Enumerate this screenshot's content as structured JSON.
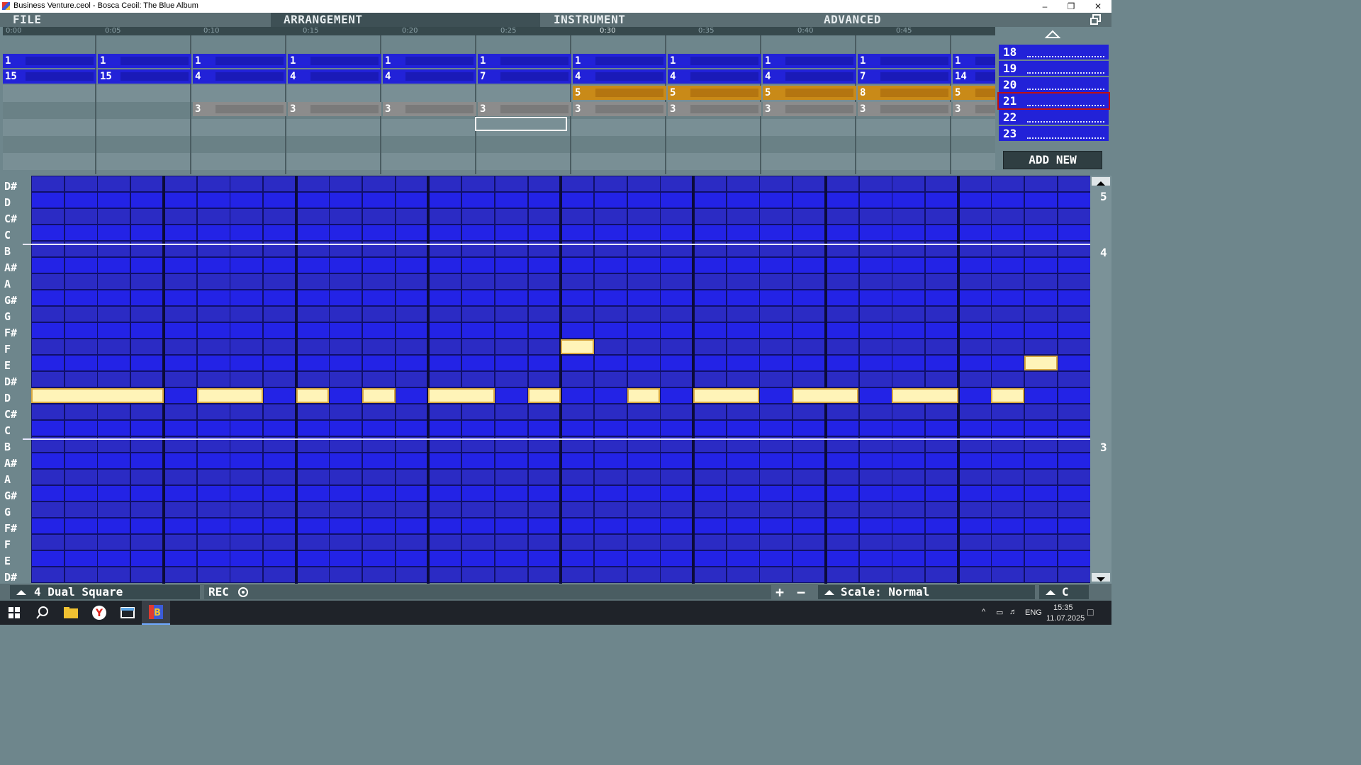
{
  "window": {
    "title": "Business Venture.ceol - Bosca Ceoil: The Blue Album",
    "minimize": "–",
    "restore": "❐",
    "close": "✕"
  },
  "menu": {
    "file": "FILE",
    "arrangement": "ARRANGEMENT",
    "instrument": "INSTRUMENT",
    "advanced": "ADVANCED",
    "fullscreen_icon": "fullscreen-icon"
  },
  "timeline": {
    "times": [
      "0:00",
      "0:05",
      "0:10",
      "0:15",
      "0:20",
      "0:25",
      "0:30",
      "0:35",
      "0:40",
      "0:45"
    ]
  },
  "arrangement": {
    "columns": [
      {
        "r1": "1",
        "r2": "15",
        "r3": "",
        "r4": ""
      },
      {
        "r1": "1",
        "r2": "15",
        "r3": "",
        "r4": ""
      },
      {
        "r1": "1",
        "r2": "4",
        "r3": "",
        "r4": "3"
      },
      {
        "r1": "1",
        "r2": "4",
        "r3": "",
        "r4": "3"
      },
      {
        "r1": "1",
        "r2": "4",
        "r3": "",
        "r4": "3"
      },
      {
        "r1": "1",
        "r2": "7",
        "r3": "",
        "r4": "3"
      },
      {
        "r1": "1",
        "r2": "4",
        "r3": "5",
        "r4": "3"
      },
      {
        "r1": "1",
        "r2": "4",
        "r3": "5",
        "r4": "3"
      },
      {
        "r1": "1",
        "r2": "4",
        "r3": "5",
        "r4": "3"
      },
      {
        "r1": "1",
        "r2": "7",
        "r3": "8",
        "r4": "3"
      },
      {
        "r1": "1",
        "r2": "14",
        "r3": "5",
        "r4": "3"
      }
    ]
  },
  "pattern_list": {
    "up_icon": "chevron-up-icon",
    "items": [
      "18",
      "19",
      "20",
      "21",
      "22",
      "23"
    ],
    "selected": "21",
    "add_new": "ADD NEW"
  },
  "piano": {
    "keys": [
      "D#",
      "D",
      "C#",
      "C",
      "B",
      "A#",
      "A",
      "G#",
      "G",
      "F#",
      "F",
      "E",
      "D#",
      "D",
      "C#",
      "C",
      "B",
      "A#",
      "A",
      "G#",
      "G",
      "F#",
      "F",
      "E",
      "D#"
    ],
    "octaves": [
      "5",
      "4",
      "3"
    ],
    "scroll_up_icon": "scroll-up-icon",
    "scroll_down_icon": "scroll-down-icon"
  },
  "bottom": {
    "instrument": "4 Dual Square",
    "rec": "REC",
    "scale": "Scale: Normal",
    "key": "C",
    "plus": "+",
    "minus": "−"
  },
  "taskbar": {
    "lang": "ENG",
    "time": "15:35",
    "date": "11.07.2025"
  },
  "colors": {
    "accent_blue": "#2222d8",
    "note": "#fff4b8",
    "pattern_orange": "#c98a18",
    "pattern_gray": "#8c8c8c"
  }
}
